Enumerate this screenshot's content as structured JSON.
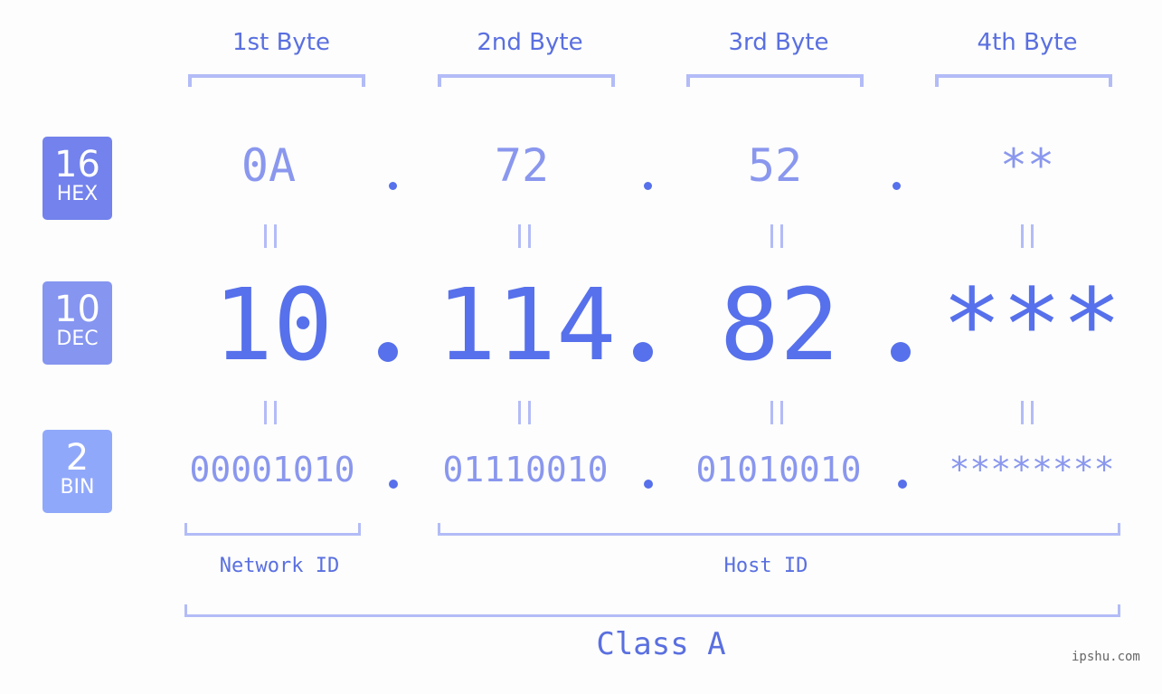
{
  "bases": [
    {
      "number": "16",
      "label": "HEX",
      "color": "#7382ec"
    },
    {
      "number": "10",
      "label": "DEC",
      "color": "#8595f0"
    },
    {
      "number": "2",
      "label": "BIN",
      "color": "#90a8fa"
    }
  ],
  "byte_labels": [
    "1st Byte",
    "2nd Byte",
    "3rd Byte",
    "4th Byte"
  ],
  "hex": [
    "0A",
    "72",
    "52",
    "**"
  ],
  "dec": [
    "10",
    "114",
    "82",
    "***"
  ],
  "bin": [
    "00001010",
    "01110010",
    "01010010",
    "********"
  ],
  "network_id_label": "Network ID",
  "host_id_label": "Host ID",
  "class_label": "Class A",
  "watermark": "ipshu.com",
  "colors": {
    "accent": "#5770eb",
    "light": "#8a97ee",
    "bracket": "#b3bcf7"
  }
}
